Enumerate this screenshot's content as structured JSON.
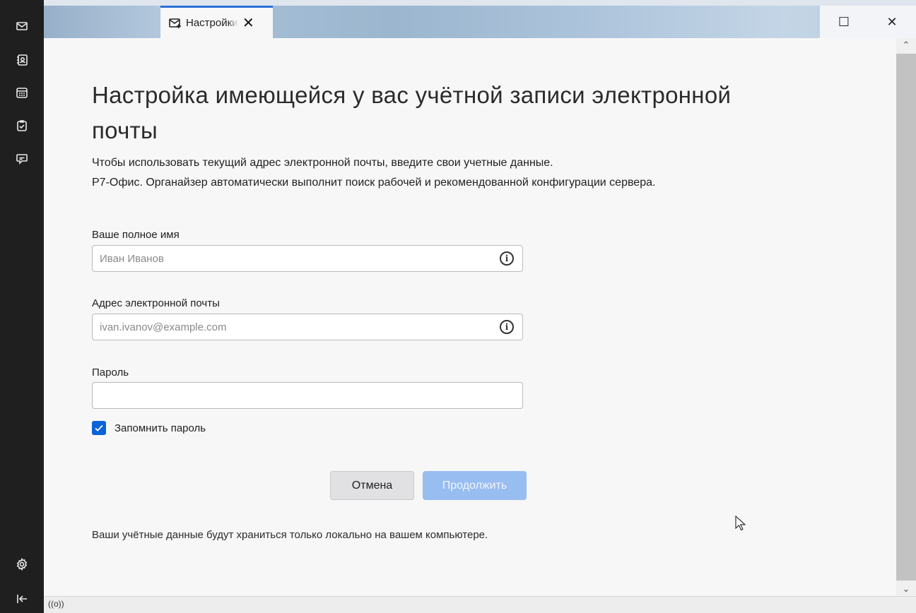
{
  "tab": {
    "title": "Настройки учётной записи"
  },
  "window_controls": {
    "maximize": "☐",
    "close": "✕"
  },
  "spaces": [
    "mail-icon",
    "address-book-icon",
    "calendar-icon",
    "tasks-icon",
    "chat-icon",
    "settings-icon",
    "collapse-icon"
  ],
  "page": {
    "heading": "Настройка имеющейся у вас учётной записи электронной почты",
    "intro_line1": "Чтобы использовать текущий адрес электронной почты, введите свои учетные данные.",
    "intro_line2": "Р7-Офис. Органайзер автоматически выполнит поиск рабочей и рекомендованной конфигурации сервера."
  },
  "form": {
    "name_label": "Ваше полное имя",
    "name_placeholder": "Иван Иванов",
    "email_label": "Адрес электронной почты",
    "email_placeholder": "ivan.ivanov@example.com",
    "password_label": "Пароль",
    "password_value": "",
    "remember_label": "Запомнить пароль",
    "remember_checked": true
  },
  "buttons": {
    "cancel": "Отмена",
    "continue": "Продолжить"
  },
  "footer": {
    "note": "Ваши учётные данные будут храниться только локально на вашем компьютере."
  },
  "statusbar": {
    "icon": "((o))"
  },
  "colors": {
    "accent": "#0a63d8",
    "continue_disabled": "#98bdf0",
    "spaces_bg": "#1f1f1f"
  }
}
